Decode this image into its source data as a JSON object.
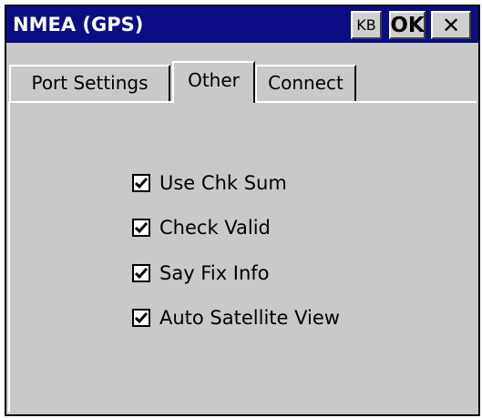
{
  "window": {
    "title": "NMEA (GPS)",
    "buttons": {
      "kb": "KB",
      "ok": "OK",
      "close": "✕"
    }
  },
  "tabs": [
    {
      "label": "Port Settings",
      "selected": false
    },
    {
      "label": "Other",
      "selected": true
    },
    {
      "label": "Connect",
      "selected": false
    }
  ],
  "options": [
    {
      "label": "Use Chk Sum",
      "checked": true
    },
    {
      "label": "Check Valid",
      "checked": true
    },
    {
      "label": "Say Fix Info",
      "checked": true
    },
    {
      "label": "Auto Satellite View",
      "checked": true
    }
  ],
  "colors": {
    "titlebar": "#0c0c84",
    "panel": "#c9c9c9"
  }
}
